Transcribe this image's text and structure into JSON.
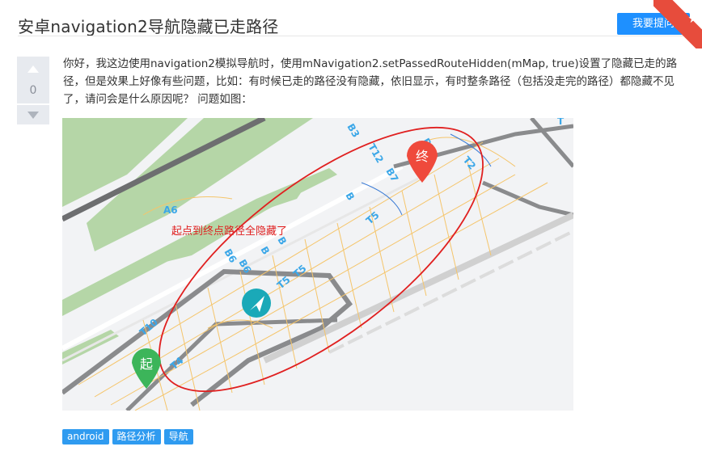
{
  "header": {
    "title": "安卓navigation2导航隐藏已走路径",
    "ask_button": "我要提问"
  },
  "vote": {
    "count": "0"
  },
  "question": {
    "text": "你好，我这边使用navigation2模拟导航时，使用mNavigation2.setPassedRouteHidden(mMap, true)设置了隐藏已走的路径，但是效果上好像有些问题，比如：有时候已走的路径没有隐藏，依旧显示，有时整条路径（包括没走完的路径）都隐藏不见了，请问会是什么原因呢？ 问题如图："
  },
  "map": {
    "annotation": "起点到终点路径全隐藏了",
    "start_marker": "起",
    "end_marker": "终",
    "labels": {
      "a6": "A6",
      "b7": "B7",
      "b6": "B6",
      "b6b": "B6",
      "b": "B",
      "b2": "B",
      "b9": "B",
      "t2": "T2",
      "t5a": "T5",
      "t5b": "T5",
      "t5c": "T5",
      "t10": "T10",
      "t4": "T4",
      "b5": "B5",
      "t12": "T12",
      "t_top": "T",
      "b3": "B3"
    }
  },
  "tags": [
    "android",
    "路径分析",
    "导航"
  ],
  "colors": {
    "accent": "#1e90ff",
    "tag": "#2f9bf0",
    "ribbon": "#e74c3c",
    "annotation_red": "#e02020",
    "green_area": "#b5d6a7",
    "road_label": "#3ba7e8"
  }
}
